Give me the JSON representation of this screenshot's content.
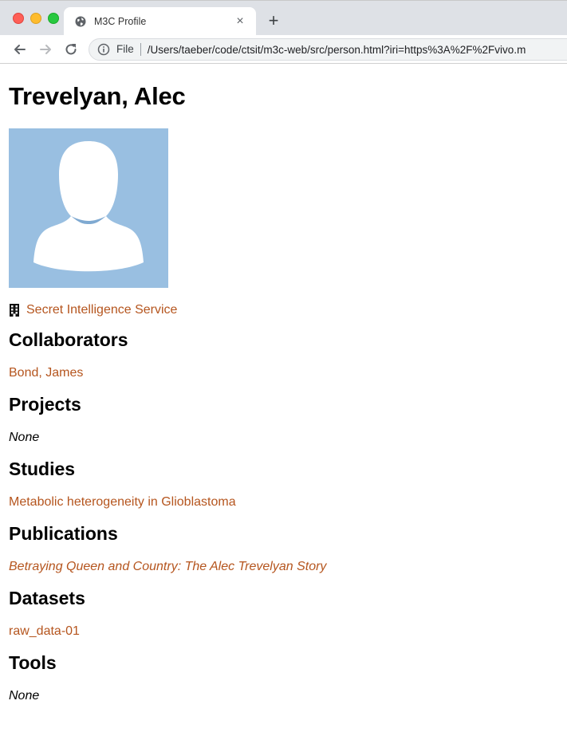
{
  "browser": {
    "tab": {
      "title": "M3C Profile",
      "close": "×"
    },
    "new_tab": "+",
    "address": {
      "scheme_label": "File",
      "url": "/Users/taeber/code/ctsit/m3c-web/src/person.html?iri=https%3A%2F%2Fvivo.m"
    }
  },
  "page": {
    "title": "Trevelyan, Alec",
    "affiliation": "Secret Intelligence Service",
    "sections": [
      {
        "heading": "Collaborators",
        "items": [
          "Bond, James"
        ]
      },
      {
        "heading": "Projects",
        "none": "None"
      },
      {
        "heading": "Studies",
        "items": [
          "Metabolic heterogeneity in Glioblastoma"
        ]
      },
      {
        "heading": "Publications",
        "items": [
          "Betraying Queen and Country: The Alec Trevelyan Story"
        ]
      },
      {
        "heading": "Datasets",
        "items": [
          "raw_data-01"
        ]
      },
      {
        "heading": "Tools",
        "none": "None"
      }
    ]
  },
  "icons": {
    "tab_favicon": "globe-icon",
    "back": "arrow-left-icon",
    "forward": "arrow-right-icon",
    "reload": "reload-icon",
    "info": "info-icon",
    "affiliation": "building-icon",
    "avatar": "person-silhouette-icon"
  },
  "colors": {
    "link": "#b5551e",
    "avatar_bg": "#99bfe1",
    "tabstrip": "#dee1e6"
  }
}
